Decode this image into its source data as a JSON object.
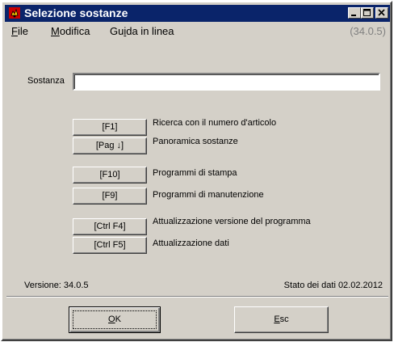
{
  "window": {
    "title": "Selezione sostanze",
    "version_header": "(34.0.5)",
    "colors": {
      "titlebar": "#0a246a",
      "face": "#d4d0c8",
      "icon": "#cc0000"
    }
  },
  "menu": [
    {
      "first": "F",
      "rest": "ile"
    },
    {
      "first": "M",
      "rest": "odifica"
    },
    {
      "prefix": "Gu",
      "first": "i",
      "rest": "da in linea"
    }
  ],
  "search": {
    "label": "Sostanza",
    "value": ""
  },
  "functions": [
    {
      "key": "[F1]",
      "label": "Ricerca con il numero d'articolo"
    },
    {
      "key": "[Pag ↓]",
      "label": "Panoramica sostanze"
    },
    {
      "key": "[F10]",
      "label": "Programmi di stampa"
    },
    {
      "key": "[F9]",
      "label": "Programmi di manutenzione"
    },
    {
      "key": "[Ctrl F4]",
      "label": "Attualizzazione versione del programma"
    },
    {
      "key": "[Ctrl F5]",
      "label": "Attualizzazione dati"
    }
  ],
  "status": {
    "version": "Versione:  34.0.5",
    "data_state": "Stato dei dati  02.02.2012"
  },
  "buttons": {
    "ok": {
      "first": "O",
      "rest": "K"
    },
    "esc": {
      "first": "E",
      "rest": "sc"
    }
  },
  "caption_icons": [
    "minimize-icon",
    "maximize-icon",
    "close-icon"
  ]
}
